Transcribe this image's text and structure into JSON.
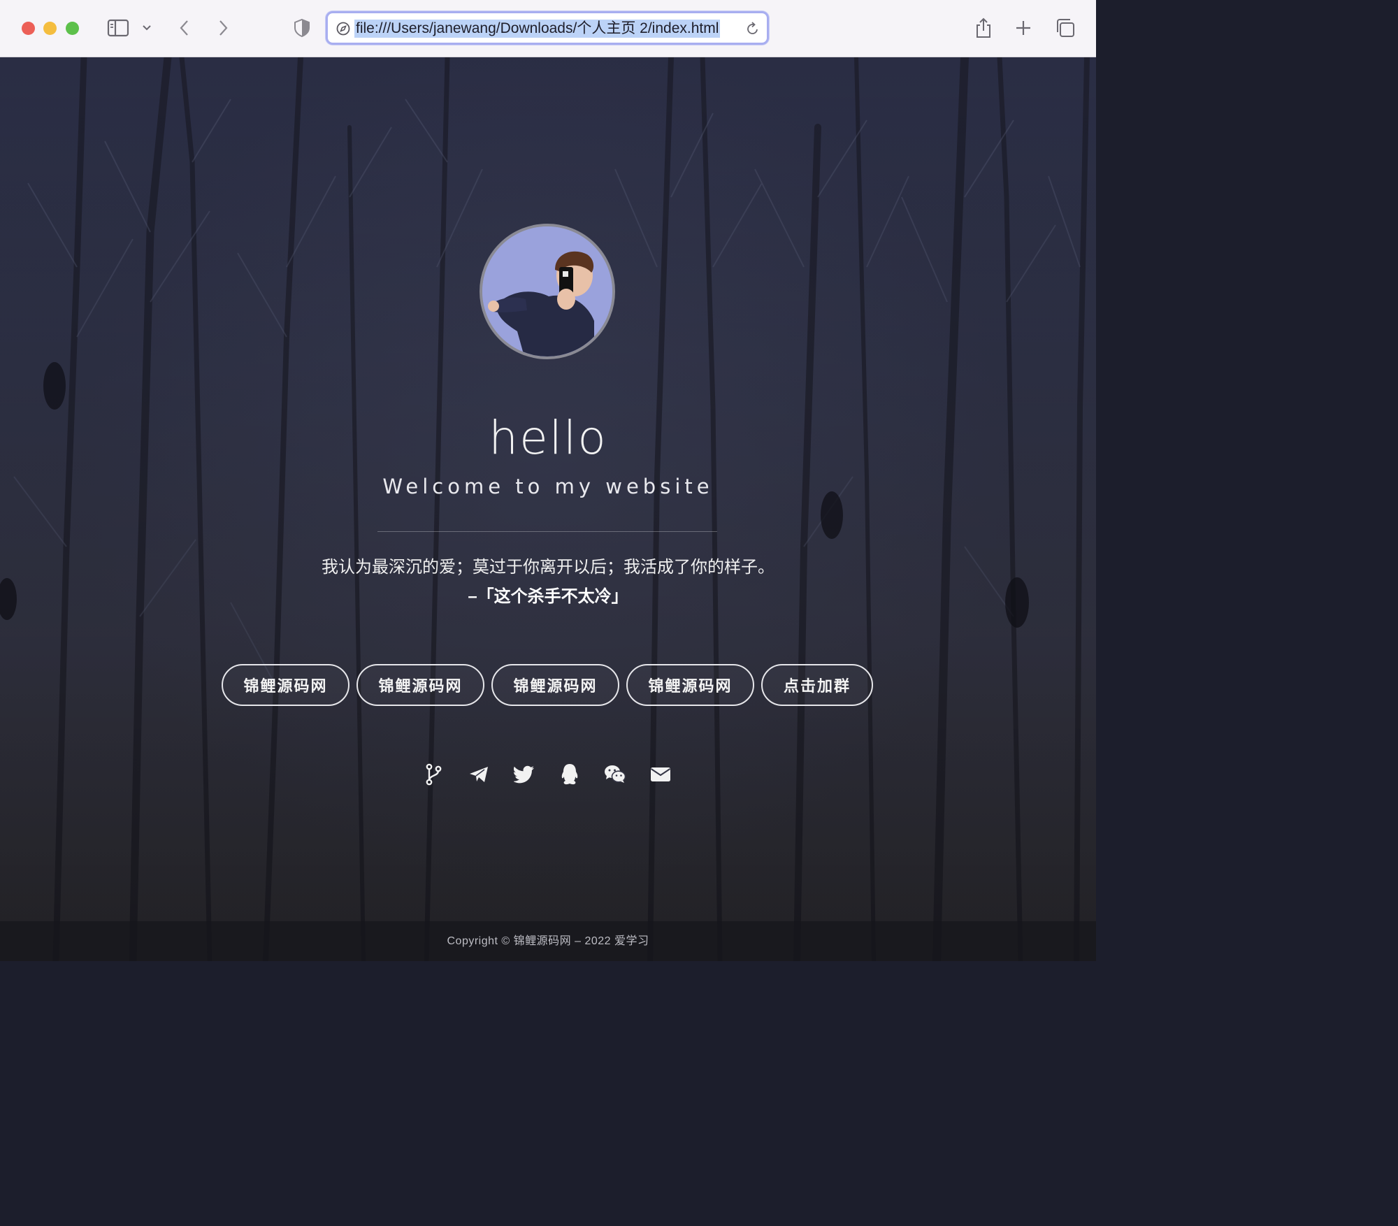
{
  "browser": {
    "url": "file:///Users/janewang/Downloads/个人主页 2/index.html",
    "icons": [
      "close-window",
      "minimize-window",
      "zoom-window",
      "sidebar-toggle",
      "chevron-down",
      "back",
      "forward",
      "privacy-shield",
      "compass",
      "reload",
      "share",
      "new-tab",
      "tab-overview"
    ]
  },
  "hero": {
    "title": "hello",
    "subtitle": "Welcome to my website",
    "quote": "我认为最深沉的爱；莫过于你离开以后；我活成了你的样子。",
    "source": "–「这个杀手不太冷」"
  },
  "buttons": [
    "锦鲤源码网",
    "锦鲤源码网",
    "锦鲤源码网",
    "锦鲤源码网",
    "点击加群"
  ],
  "social_icons": [
    "git-branch-icon",
    "telegram-icon",
    "twitter-icon",
    "qq-icon",
    "wechat-icon",
    "email-icon"
  ],
  "footer": {
    "copyright": "Copyright © 锦鲤源码网 – 2022 爱学习"
  },
  "colors": {
    "accent_url_border": "#a8aef0",
    "url_selection": "#bcd3f7",
    "avatar_bg": "#9aa2dc"
  }
}
